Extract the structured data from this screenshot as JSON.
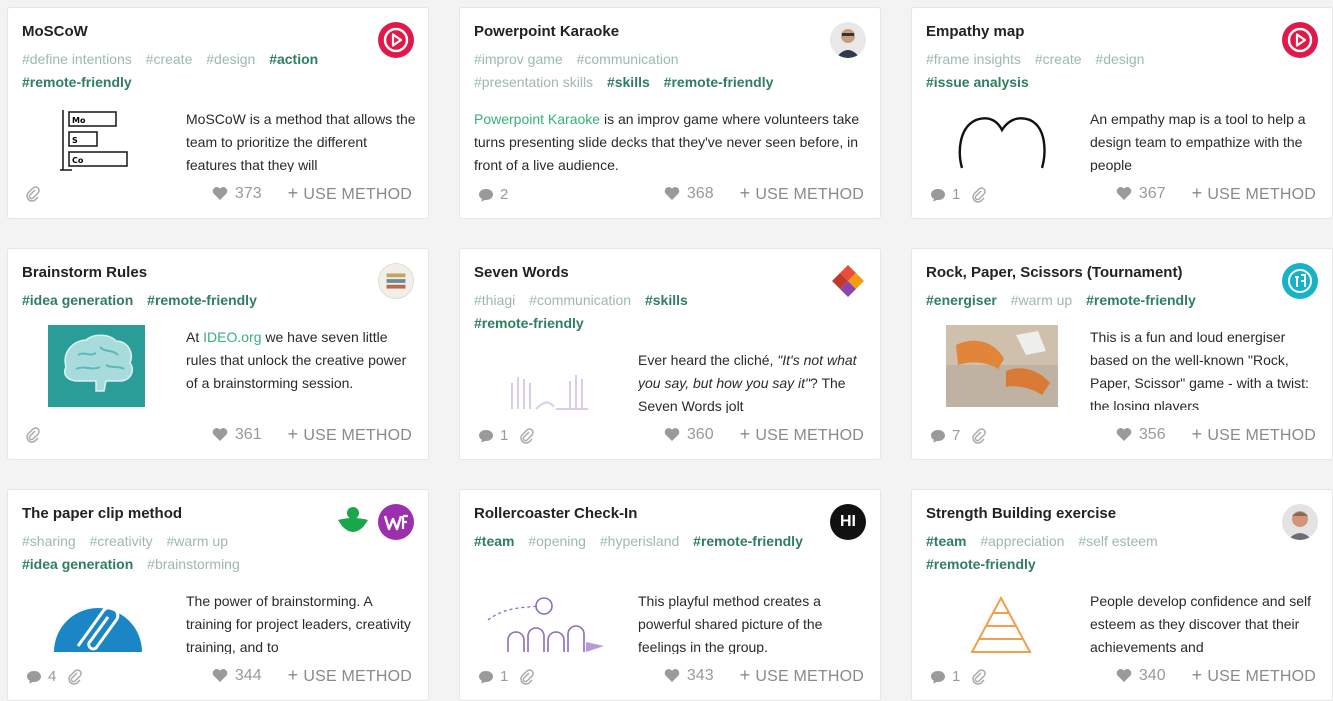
{
  "add_label": "+",
  "cards": [
    {
      "title": "MoSCoW",
      "tags": [
        {
          "text": "#define intentions",
          "strong": false
        },
        {
          "text": "#create",
          "strong": false
        },
        {
          "text": "#design",
          "strong": false
        },
        {
          "text": "#action",
          "strong": true
        },
        {
          "text": "#remote-friendly",
          "strong": true
        }
      ],
      "thumb_labels": [
        "Mo",
        "S",
        "Co"
      ],
      "desc": [
        "MoSCoW is a method that allows the team to prioritize the different features that they will"
      ],
      "comments": "",
      "likes": "373",
      "use_label": "USE METHOD"
    },
    {
      "title": "Powerpoint Karaoke",
      "tags": [
        {
          "text": "#improv game",
          "strong": false
        },
        {
          "text": "#communication",
          "strong": false
        },
        {
          "text": "#presentation skills",
          "strong": false
        },
        {
          "text": "#skills",
          "strong": true
        },
        {
          "text": "#remote-friendly",
          "strong": true
        }
      ],
      "desc_link": "Powerpoint Karaoke",
      "desc": [
        " is an improv game where volunteers take turns presenting slide decks that they've never seen before, in front of a live audience."
      ],
      "comments": "2",
      "likes": "368",
      "use_label": "USE METHOD"
    },
    {
      "title": "Empathy map",
      "tags": [
        {
          "text": "#frame insights",
          "strong": false
        },
        {
          "text": "#create",
          "strong": false
        },
        {
          "text": "#design",
          "strong": false
        },
        {
          "text": "#issue analysis",
          "strong": true
        }
      ],
      "desc": [
        "An empathy map is a tool to help a design team to empathize with the people"
      ],
      "comments": "1",
      "likes": "367",
      "use_label": "USE METHOD"
    },
    {
      "title": "Brainstorm Rules",
      "tags": [
        {
          "text": "#idea generation",
          "strong": true
        },
        {
          "text": "#remote-friendly",
          "strong": true
        }
      ],
      "desc_prefix": "At ",
      "desc_link": "IDEO.org",
      "desc": [
        " we have seven little rules that unlock the creative power of a brainstorming session."
      ],
      "comments": "",
      "likes": "361",
      "use_label": "USE METHOD"
    },
    {
      "title": "Seven Words",
      "tags": [
        {
          "text": "#thiagi",
          "strong": false
        },
        {
          "text": "#communication",
          "strong": false
        },
        {
          "text": "#skills",
          "strong": true
        },
        {
          "text": "#remote-friendly",
          "strong": true
        }
      ],
      "desc_prefix": "Ever heard the cliché, ",
      "desc_em": "\"It's not what you say, but how you say it\"",
      "desc": [
        "? The Seven Words jolt"
      ],
      "comments": "1",
      "likes": "360",
      "use_label": "USE METHOD"
    },
    {
      "title": "Rock, Paper, Scissors (Tournament)",
      "tags": [
        {
          "text": "#energiser",
          "strong": true
        },
        {
          "text": "#warm up",
          "strong": false
        },
        {
          "text": "#remote-friendly",
          "strong": true
        }
      ],
      "desc": [
        "This is a fun and loud energiser based on the well-known \"Rock, Paper, Scissor\" game - with a twist: the losing players"
      ],
      "comments": "7",
      "likes": "356",
      "use_label": "USE METHOD"
    },
    {
      "title": "The paper clip method",
      "tags": [
        {
          "text": "#sharing",
          "strong": false
        },
        {
          "text": "#creativity",
          "strong": false
        },
        {
          "text": "#warm up",
          "strong": false
        },
        {
          "text": "#idea generation",
          "strong": true
        },
        {
          "text": "#brainstorming",
          "strong": false
        }
      ],
      "desc": [
        "The power of brainstorming. A training for project leaders, creativity training, and to"
      ],
      "comments": "4",
      "likes": "344",
      "use_label": "USE METHOD"
    },
    {
      "title": "Rollercoaster Check-In",
      "tags": [
        {
          "text": "#team",
          "strong": true
        },
        {
          "text": "#opening",
          "strong": false
        },
        {
          "text": "#hyperisland",
          "strong": false
        },
        {
          "text": "#remote-friendly",
          "strong": true
        }
      ],
      "avatar_text": "HI",
      "desc": [
        "This playful method creates a powerful shared picture of the feelings in the group."
      ],
      "comments": "1",
      "likes": "343",
      "use_label": "USE METHOD"
    },
    {
      "title": "Strength Building exercise",
      "tags": [
        {
          "text": "#team",
          "strong": true
        },
        {
          "text": "#appreciation",
          "strong": false
        },
        {
          "text": "#self esteem",
          "strong": false
        },
        {
          "text": "#remote-friendly",
          "strong": true
        }
      ],
      "desc": [
        "People develop confidence and self esteem as they discover that their achievements and"
      ],
      "comments": "1",
      "likes": "340",
      "use_label": "USE METHOD"
    }
  ]
}
